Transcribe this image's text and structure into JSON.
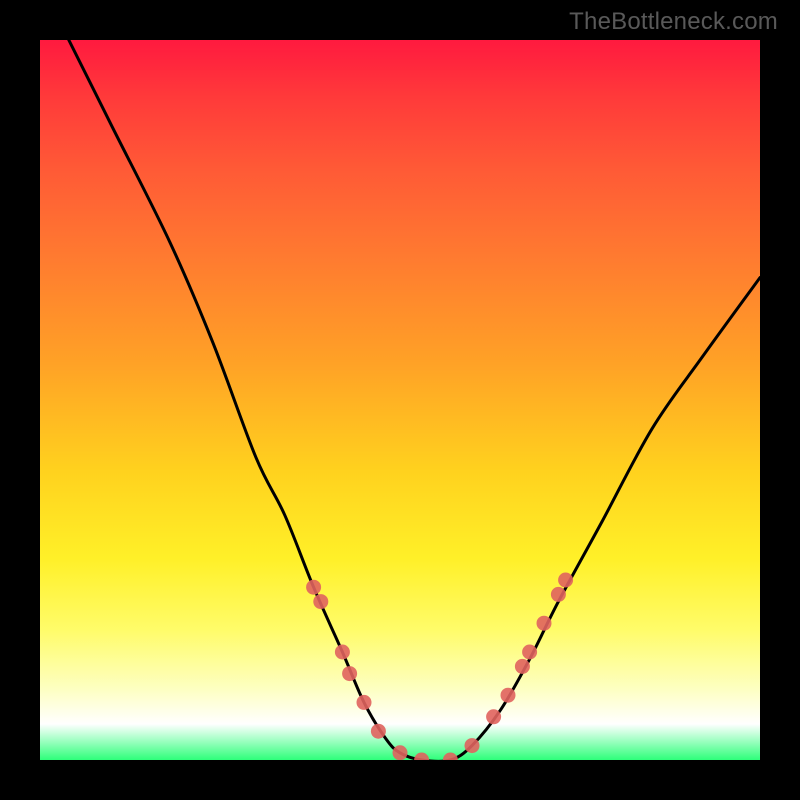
{
  "watermark": "TheBottleneck.com",
  "chart_data": {
    "type": "line",
    "title": "",
    "xlabel": "",
    "ylabel": "",
    "xlim": [
      0,
      100
    ],
    "ylim": [
      0,
      100
    ],
    "grid": false,
    "legend": false,
    "series": [
      {
        "name": "bottleneck-curve",
        "x": [
          4,
          10,
          18,
          24,
          30,
          34,
          38,
          42,
          45,
          48,
          50,
          53,
          57,
          60,
          64,
          68,
          72,
          78,
          85,
          92,
          100
        ],
        "y": [
          100,
          88,
          72,
          58,
          42,
          34,
          24,
          15,
          8,
          3,
          1,
          0,
          0,
          2,
          7,
          14,
          22,
          33,
          46,
          56,
          67
        ],
        "color": "#000000"
      }
    ],
    "markers": {
      "name": "data-points",
      "color": "#e0635e",
      "points": [
        {
          "x": 38,
          "y": 24
        },
        {
          "x": 39,
          "y": 22
        },
        {
          "x": 42,
          "y": 15
        },
        {
          "x": 43,
          "y": 12
        },
        {
          "x": 45,
          "y": 8
        },
        {
          "x": 47,
          "y": 4
        },
        {
          "x": 50,
          "y": 1
        },
        {
          "x": 53,
          "y": 0
        },
        {
          "x": 57,
          "y": 0
        },
        {
          "x": 60,
          "y": 2
        },
        {
          "x": 63,
          "y": 6
        },
        {
          "x": 65,
          "y": 9
        },
        {
          "x": 67,
          "y": 13
        },
        {
          "x": 68,
          "y": 15
        },
        {
          "x": 70,
          "y": 19
        },
        {
          "x": 72,
          "y": 23
        },
        {
          "x": 73,
          "y": 25
        }
      ]
    }
  }
}
